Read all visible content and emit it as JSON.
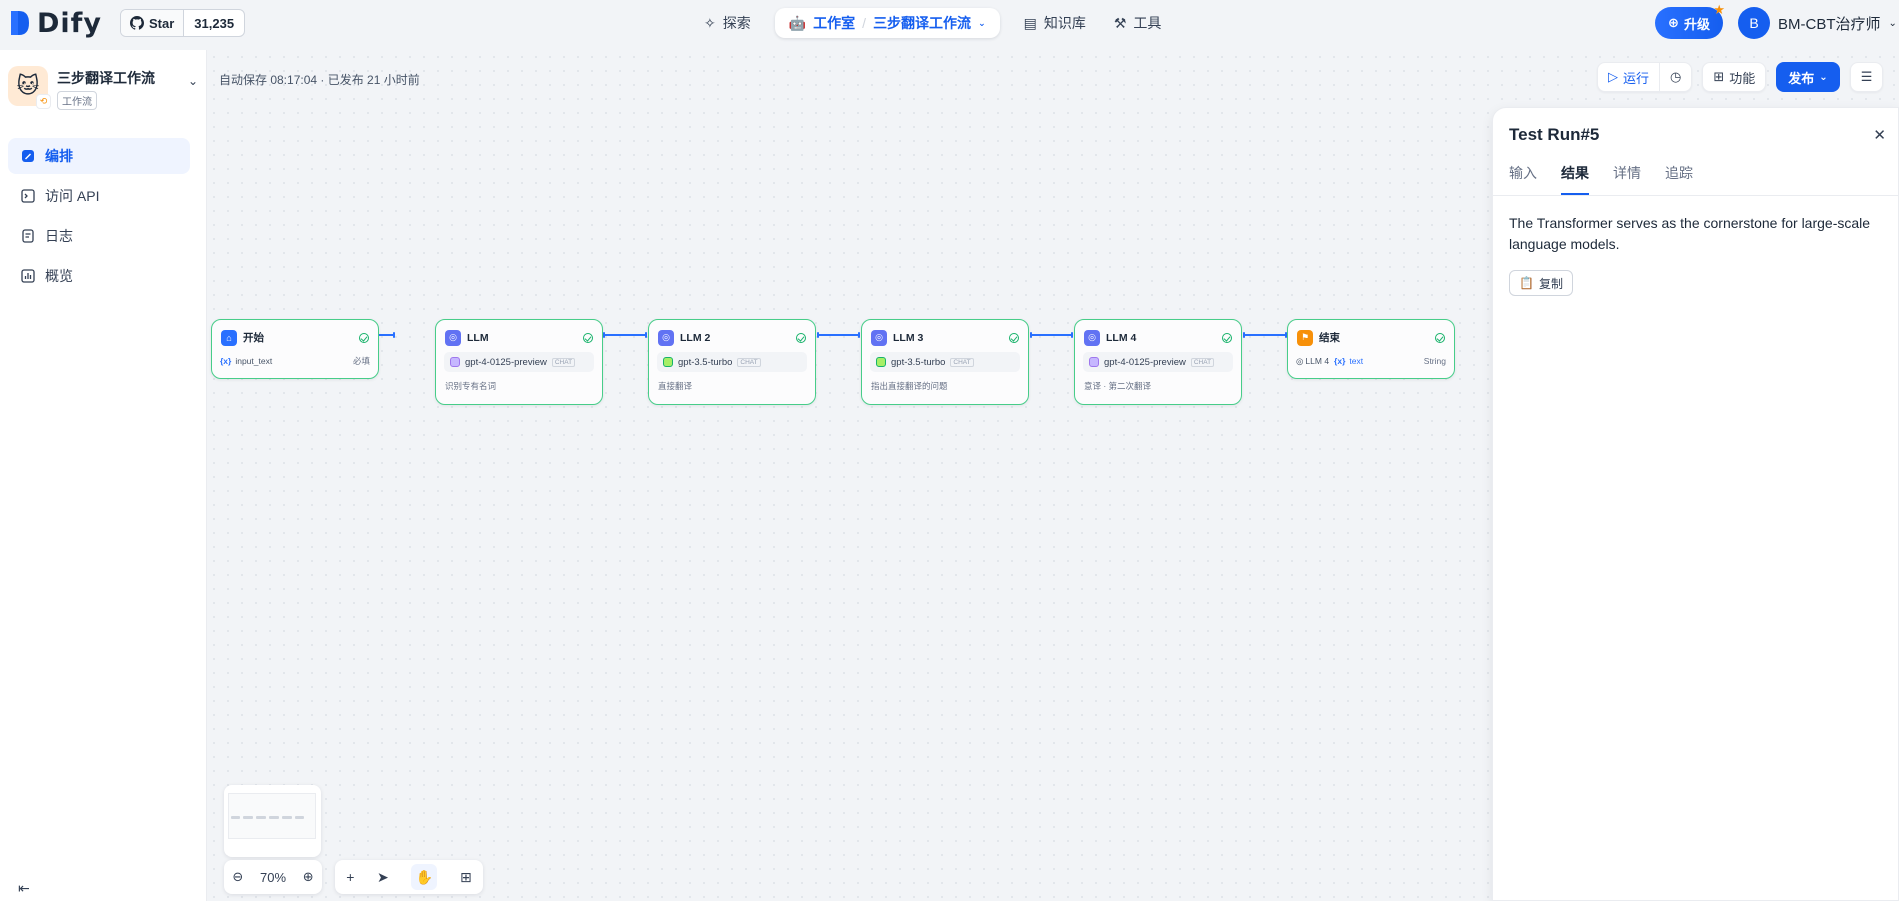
{
  "header": {
    "logo_text": "Dify",
    "github": {
      "star_label": "Star",
      "count": "31,235"
    },
    "nav": [
      {
        "label": "探索"
      },
      {
        "label": "工作室"
      },
      {
        "label": "知识库"
      },
      {
        "label": "工具"
      }
    ],
    "current_app": "三步翻译工作流",
    "upgrade_label": "升级",
    "user": {
      "initial": "B",
      "name": "BM-CBT治疗师"
    }
  },
  "sidebar": {
    "app_name": "三步翻译工作流",
    "app_type": "工作流",
    "items": [
      {
        "label": "编排",
        "icon": "edit-icon",
        "active": true
      },
      {
        "label": "访问 API",
        "icon": "terminal-icon"
      },
      {
        "label": "日志",
        "icon": "log-icon"
      },
      {
        "label": "概览",
        "icon": "chart-icon"
      }
    ]
  },
  "toolbar": {
    "autosave": "自动保存 08:17:04 · 已发布 21 小时前",
    "run_label": "运行",
    "features_label": "功能",
    "publish_label": "发布"
  },
  "nodes": [
    {
      "title": "开始",
      "var": "input_text",
      "var_tag": "必填",
      "icon": "home-icon"
    },
    {
      "title": "LLM",
      "model": "gpt-4-0125-preview",
      "model_tag": "CHAT",
      "desc": "识别专有名词"
    },
    {
      "title": "LLM 2",
      "model": "gpt-3.5-turbo",
      "model_tag": "CHAT",
      "desc": "直接翻译"
    },
    {
      "title": "LLM 3",
      "model": "gpt-3.5-turbo",
      "model_tag": "CHAT",
      "desc": "指出直接翻译的问题"
    },
    {
      "title": "LLM 4",
      "model": "gpt-4-0125-preview",
      "model_tag": "CHAT",
      "desc": "意译 · 第二次翻译"
    },
    {
      "title": "结束",
      "src_node": "LLM 4",
      "var": "text",
      "type": "String"
    }
  ],
  "canvas_controls": {
    "zoom": "70%"
  },
  "test_run": {
    "title": "Test Run#5",
    "tabs": [
      "输入",
      "结果",
      "详情",
      "追踪"
    ],
    "active_tab": "结果",
    "result": "The Transformer serves as the cornerstone for large-scale language models.",
    "copy_label": "复制"
  },
  "colors": {
    "accent": "#155eef",
    "node_border": "#47cd89",
    "end_icon": "#f79009"
  }
}
